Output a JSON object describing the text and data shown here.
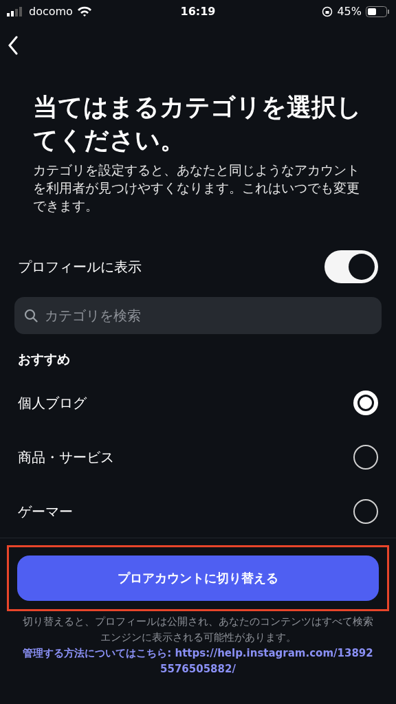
{
  "status_bar": {
    "carrier": "docomo",
    "time": "16:19",
    "battery": "45%"
  },
  "title": "当てはまるカテゴリを選択してください。",
  "description": "カテゴリを設定すると、あなたと同じようなアカウントを利用者が見つけやすくなります。これはいつでも変更できます。",
  "profile_toggle": {
    "label": "プロフィールに表示",
    "on": true
  },
  "search": {
    "placeholder": "カテゴリを検索"
  },
  "section_title": "おすすめ",
  "categories": [
    {
      "label": "個人ブログ",
      "selected": true
    },
    {
      "label": "商品・サービス",
      "selected": false
    },
    {
      "label": "ゲーマー",
      "selected": false
    }
  ],
  "primary_button": {
    "label": "プロアカウントに切り替える",
    "highlighted": true
  },
  "footer": {
    "text": "切り替えると、プロフィールは公開され、あなたのコンテンツはすべて検索エンジンに表示される可能性があります。",
    "link": "管理する方法についてはこちら: https://help.instagram.com/138925576505882/"
  }
}
